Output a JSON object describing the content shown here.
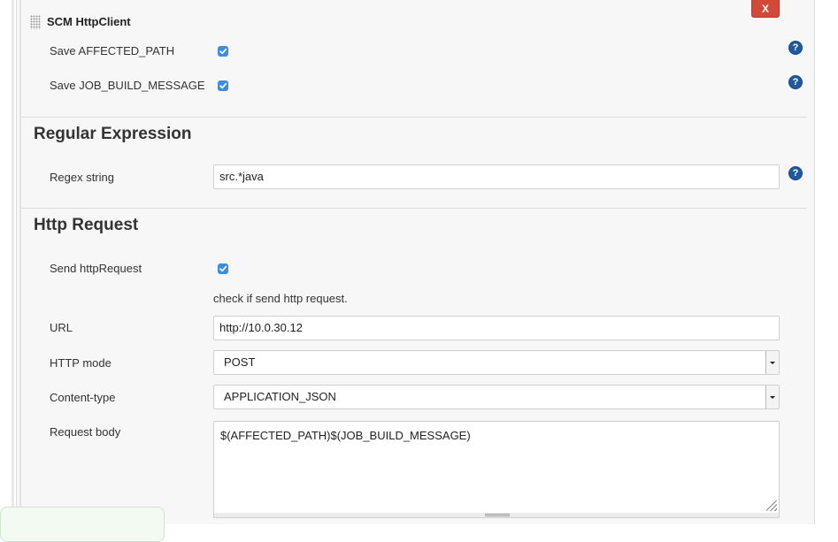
{
  "section": {
    "title": "SCM HttpClient",
    "close_label": "X"
  },
  "scm": {
    "rows": [
      {
        "label": "Save AFFECTED_PATH",
        "checked": true
      },
      {
        "label": "Save JOB_BUILD_MESSAGE",
        "checked": true
      }
    ]
  },
  "regex": {
    "heading": "Regular Expression",
    "label": "Regex string",
    "value": "src.*java"
  },
  "http": {
    "heading": "Http Request",
    "send_label": "Send httpRequest",
    "send_checked": true,
    "send_hint": "check if send http request.",
    "url_label": "URL",
    "url_value": "http://10.0.30.12",
    "mode_label": "HTTP mode",
    "mode_value": "POST",
    "content_type_label": "Content-type",
    "content_type_value": "APPLICATION_JSON",
    "body_label": "Request body",
    "body_value": "$(AFFECTED_PATH)$(JOB_BUILD_MESSAGE)"
  },
  "help_glyph": "?",
  "colors": {
    "close_button": "#d24939",
    "checkbox": "#3d8ce0",
    "help_icon": "#1f5a9e"
  }
}
